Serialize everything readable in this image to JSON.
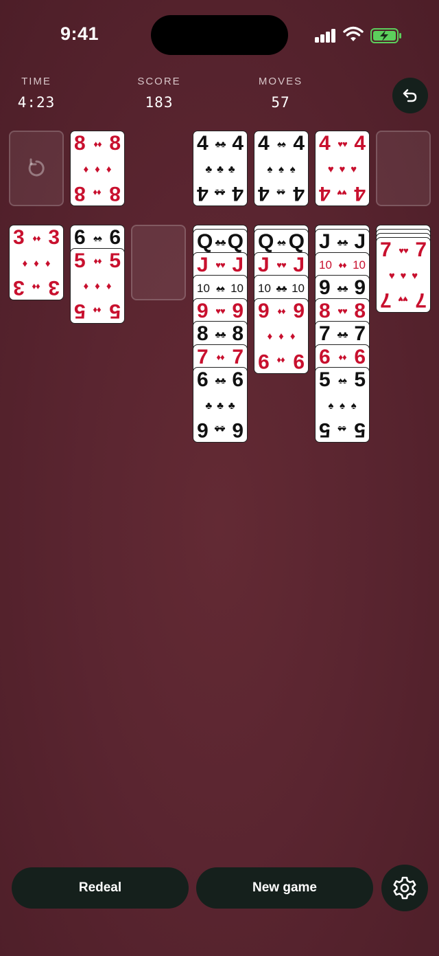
{
  "status_bar": {
    "time": "9:41"
  },
  "stats": {
    "time_label": "TIME",
    "time_value": "4:23",
    "score_label": "SCORE",
    "score_value": "183",
    "moves_label": "MOVES",
    "moves_value": "57"
  },
  "icons": {
    "undo": "undo-arrow-icon",
    "redeal_stock": "refresh-icon",
    "settings": "gear-icon"
  },
  "colors": {
    "red_suit": "#c8102e",
    "black_suit": "#111111",
    "button_bg": "#15201c",
    "felt": "#5a2530"
  },
  "waste": [
    {
      "rank": "8",
      "suit": "♦"
    }
  ],
  "foundations": [
    {
      "rank": "4",
      "suit": "♣"
    },
    {
      "rank": "4",
      "suit": "♠"
    },
    {
      "rank": "4",
      "suit": "♥"
    },
    null
  ],
  "tableau": [
    {
      "face_down": 0,
      "face_up": [
        {
          "rank": "3",
          "suit": "♦"
        }
      ]
    },
    {
      "face_down": 0,
      "face_up": [
        {
          "rank": "6",
          "suit": "♠"
        },
        {
          "rank": "5",
          "suit": "♦"
        }
      ]
    },
    {
      "face_down": 0,
      "face_up": []
    },
    {
      "face_down": 1,
      "face_up": [
        {
          "rank": "Q",
          "suit": "♣"
        },
        {
          "rank": "J",
          "suit": "♥"
        },
        {
          "rank": "10",
          "suit": "♠"
        },
        {
          "rank": "9",
          "suit": "♥"
        },
        {
          "rank": "8",
          "suit": "♣"
        },
        {
          "rank": "7",
          "suit": "♦"
        },
        {
          "rank": "6",
          "suit": "♣"
        }
      ]
    },
    {
      "face_down": 1,
      "face_up": [
        {
          "rank": "Q",
          "suit": "♠"
        },
        {
          "rank": "J",
          "suit": "♥"
        },
        {
          "rank": "10",
          "suit": "♣"
        },
        {
          "rank": "9",
          "suit": "♦"
        }
      ]
    },
    {
      "face_down": 1,
      "face_up": [
        {
          "rank": "J",
          "suit": "♣"
        },
        {
          "rank": "10",
          "suit": "♦"
        },
        {
          "rank": "9",
          "suit": "♣"
        },
        {
          "rank": "8",
          "suit": "♥"
        },
        {
          "rank": "7",
          "suit": "♣"
        },
        {
          "rank": "6",
          "suit": "♦"
        },
        {
          "rank": "5",
          "suit": "♠"
        }
      ]
    },
    {
      "face_down": 3,
      "face_up": [
        {
          "rank": "7",
          "suit": "♥"
        }
      ]
    }
  ],
  "buttons": {
    "redeal": "Redeal",
    "new_game": "New game"
  }
}
